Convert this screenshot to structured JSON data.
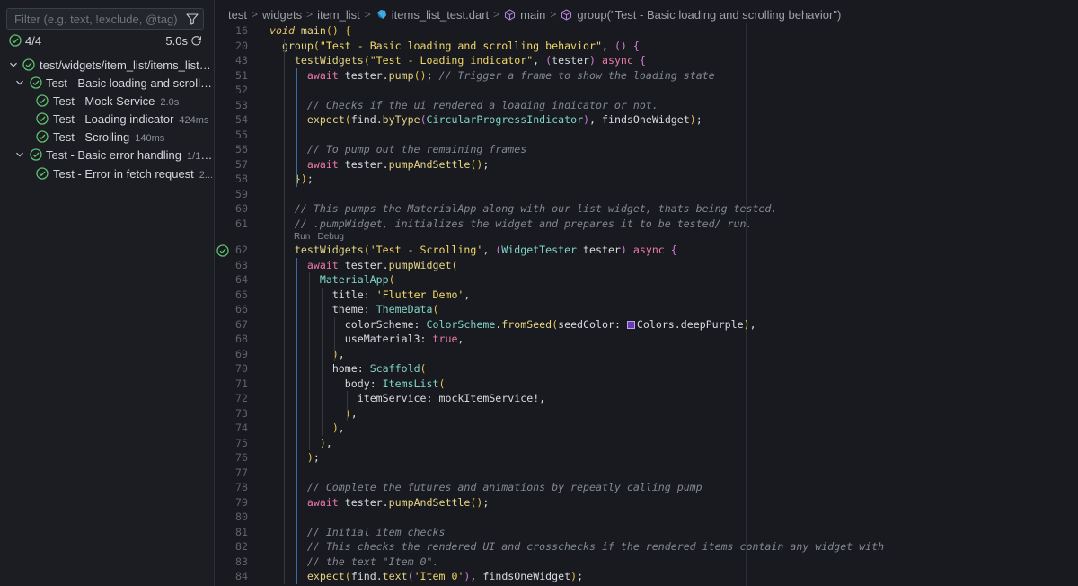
{
  "sidebar": {
    "filter_placeholder": "Filter (e.g. text, !exclude, @tag)",
    "summary_count": "4/4",
    "summary_time": "5.0s",
    "tree": [
      {
        "label": "test/widgets/item_list/items_list_...",
        "duration": ""
      },
      {
        "label": "Test - Basic loading and scrollin...",
        "duration": ""
      },
      {
        "label": "Test - Mock Service",
        "duration": "2.0s"
      },
      {
        "label": "Test - Loading indicator",
        "duration": "424ms"
      },
      {
        "label": "Test - Scrolling",
        "duration": "140ms"
      },
      {
        "label": "Test - Basic error handling",
        "duration": "1/1 p..."
      },
      {
        "label": "Test - Error in fetch request",
        "duration": "2..."
      }
    ]
  },
  "breadcrumb": {
    "items": [
      "test",
      "widgets",
      "item_list",
      "items_list_test.dart",
      "main",
      "group(\"Test - Basic loading and scrolling behavior\")"
    ]
  },
  "code": {
    "lens": "Run | Debug",
    "lines": [
      {
        "n": "16",
        "t": "void main() {"
      },
      {
        "n": "20",
        "t": "  group(\"Test - Basic loading and scrolling behavior\", () {"
      },
      {
        "n": "43",
        "t": "    testWidgets(\"Test - Loading indicator\", (tester) async {"
      },
      {
        "n": "51",
        "t": "      await tester.pump(); // Trigger a frame to show the loading state"
      },
      {
        "n": "52",
        "t": ""
      },
      {
        "n": "53",
        "t": "      // Checks if the ui rendered a loading indicator or not."
      },
      {
        "n": "54",
        "t": "      expect(find.byType(CircularProgressIndicator), findsOneWidget);"
      },
      {
        "n": "55",
        "t": ""
      },
      {
        "n": "56",
        "t": "      // To pump out the remaining frames"
      },
      {
        "n": "57",
        "t": "      await tester.pumpAndSettle();"
      },
      {
        "n": "58",
        "t": "    });"
      },
      {
        "n": "59",
        "t": ""
      },
      {
        "n": "60",
        "t": "    // This pumps the MaterialApp along with our list widget, thats being tested."
      },
      {
        "n": "61",
        "t": "    // .pumpWidget, initializes the widget and prepares it to be tested/ run."
      },
      {
        "n": "62",
        "t": "    testWidgets('Test - Scrolling', (WidgetTester tester) async {"
      },
      {
        "n": "63",
        "t": "      await tester.pumpWidget("
      },
      {
        "n": "64",
        "t": "        MaterialApp("
      },
      {
        "n": "65",
        "t": "          title: 'Flutter Demo',"
      },
      {
        "n": "66",
        "t": "          theme: ThemeData("
      },
      {
        "n": "67",
        "t": "            colorScheme: ColorScheme.fromSeed(seedColor: Colors.deepPurple),"
      },
      {
        "n": "68",
        "t": "            useMaterial3: true,"
      },
      {
        "n": "69",
        "t": "          ),"
      },
      {
        "n": "70",
        "t": "          home: Scaffold("
      },
      {
        "n": "71",
        "t": "            body: ItemsList("
      },
      {
        "n": "72",
        "t": "              itemService: mockItemService!,"
      },
      {
        "n": "73",
        "t": "            ),"
      },
      {
        "n": "74",
        "t": "          ),"
      },
      {
        "n": "75",
        "t": "        ),"
      },
      {
        "n": "76",
        "t": "      );"
      },
      {
        "n": "77",
        "t": ""
      },
      {
        "n": "78",
        "t": "      // Complete the futures and animations by repeatly calling pump"
      },
      {
        "n": "79",
        "t": "      await tester.pumpAndSettle();"
      },
      {
        "n": "80",
        "t": ""
      },
      {
        "n": "81",
        "t": "      // Initial item checks"
      },
      {
        "n": "82",
        "t": "      // This checks the rendered UI and crosschecks if the rendered items contain any widget with"
      },
      {
        "n": "83",
        "t": "      // the text \"Item 0\"."
      },
      {
        "n": "84",
        "t": "      expect(find.text('Item 0'), findsOneWidget);"
      }
    ]
  },
  "colors": {
    "pass_green": "#5fbf6f",
    "swatch": "#673ab7"
  },
  "icons": [
    "filter-icon",
    "check-circle-icon",
    "rerun-icon",
    "chevron-down-icon",
    "dart-file-icon",
    "symbol-method-icon"
  ]
}
